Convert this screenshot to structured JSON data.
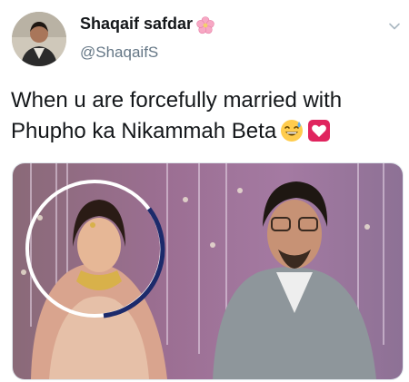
{
  "tweet": {
    "author_name": "Shaqaif safdar",
    "author_handle": "@ShaqaifS",
    "text_line_1": "When u are forcefully married with",
    "text_line_2": "Phupho ka Nikammah Beta",
    "name_emoji": "cherry-blossom-icon",
    "text_emojis": [
      "grinning-sweat-icon",
      "heart-box-icon"
    ]
  },
  "colors": {
    "name": "#14171a",
    "handle": "#657786",
    "heart_box": "#e0245e",
    "circle_white": "#ffffff",
    "circle_navy": "#1c2a6b"
  }
}
